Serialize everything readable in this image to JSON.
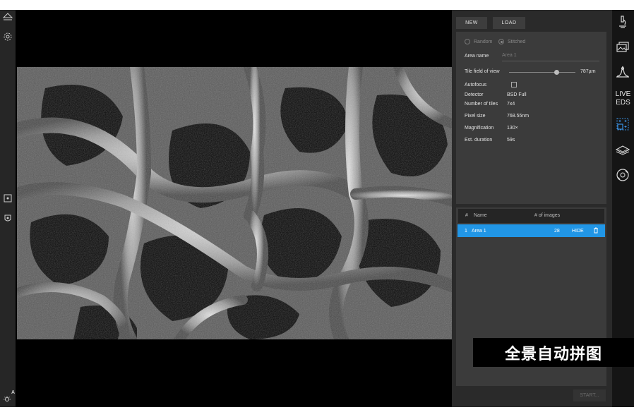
{
  "left_rail": {
    "icons": [
      "eject-icon",
      "settings-gear-icon",
      "camera-1-icon",
      "camera-2-icon",
      "auto-brightness-icon"
    ],
    "auto_brightness_letter": "A"
  },
  "viewport": {
    "image_alt": "SEM micrograph of porous structure"
  },
  "panel": {
    "new_label": "NEW",
    "load_label": "LOAD",
    "mode_random": "Random",
    "mode_stitched": "Stitched",
    "area_name_label": "Area name",
    "area_name_value": "Area 1",
    "tile_fov_label": "Tile field of view",
    "tile_fov_value": "787µm",
    "tile_fov_fraction": 0.72,
    "autofocus_label": "Autofocus",
    "detector_label": "Detector",
    "detector_value": "BSD Full",
    "tiles_label": "Number of tiles",
    "tiles_value": "7x4",
    "pixel_size_label": "Pixel size",
    "pixel_size_value": "768.55nm",
    "magnification_label": "Magnification",
    "magnification_value": "130×",
    "duration_label": "Est. duration",
    "duration_value": "59s",
    "table": {
      "col_num": "#",
      "col_name": "Name",
      "col_images": "# of images",
      "rows": [
        {
          "num": "1",
          "name": "Area 1",
          "images": "28",
          "action": "HIDE"
        }
      ]
    },
    "start_label": "START..."
  },
  "toolbar": {
    "live_eds": [
      "LIVE",
      "EDS"
    ]
  },
  "caption": "全景自动拼图",
  "colors": {
    "accent": "#2196e6",
    "panel_bg": "#2a2a2a",
    "box_bg": "#3b3b3b"
  }
}
